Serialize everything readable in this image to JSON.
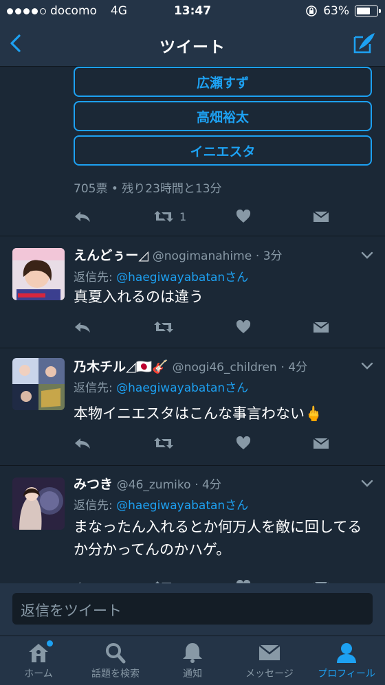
{
  "status_bar": {
    "carrier": "docomo",
    "network": "4G",
    "time": "13:47",
    "battery": "63%",
    "battery_level": 0.63,
    "signal_bars": 4
  },
  "nav": {
    "title": "ツイート",
    "back_icon": "chevron-left-icon",
    "compose_icon": "compose-quill-icon"
  },
  "poll": {
    "options": [
      "広瀬すず",
      "高畑裕太",
      "イニエスタ"
    ],
    "meta": "705票 • 残り23時間と13分",
    "retweet_count": "1"
  },
  "tweets": [
    {
      "name": "えんどぅー◿",
      "handle": "@nogimanahime",
      "time": "· 3分",
      "reply_prefix": "返信先: ",
      "reply_to": "@haegiwayabatan",
      "reply_suffix": "さん",
      "text": "真夏入れるのは違う"
    },
    {
      "name": "乃木チル◿🇯🇵🎸",
      "handle": "@nogi46_children",
      "time": "· 4分",
      "reply_prefix": "返信先: ",
      "reply_to": "@haegiwayabatan",
      "reply_suffix": "さん",
      "text": "本物イニエスタはこんな事言わない🖕"
    },
    {
      "name": "みつき",
      "handle": "@46_zumiko",
      "time": "· 4分",
      "reply_prefix": "返信先: ",
      "reply_to": "@haegiwayabatan",
      "reply_suffix": "さん",
      "text": "まなったん入れるとか何万人を敵に回してるか分かってんのかハゲ。"
    }
  ],
  "reply_box": {
    "placeholder": "返信をツイート"
  },
  "tabs": [
    {
      "label": "ホーム",
      "icon": "home-icon"
    },
    {
      "label": "話題を検索",
      "icon": "search-icon"
    },
    {
      "label": "通知",
      "icon": "bell-icon"
    },
    {
      "label": "メッセージ",
      "icon": "envelope-icon"
    },
    {
      "label": "プロフィール",
      "icon": "person-icon"
    }
  ],
  "colors": {
    "accent": "#1da1f2",
    "background": "#1b2836",
    "bar": "#243447",
    "muted": "#8899a6"
  }
}
